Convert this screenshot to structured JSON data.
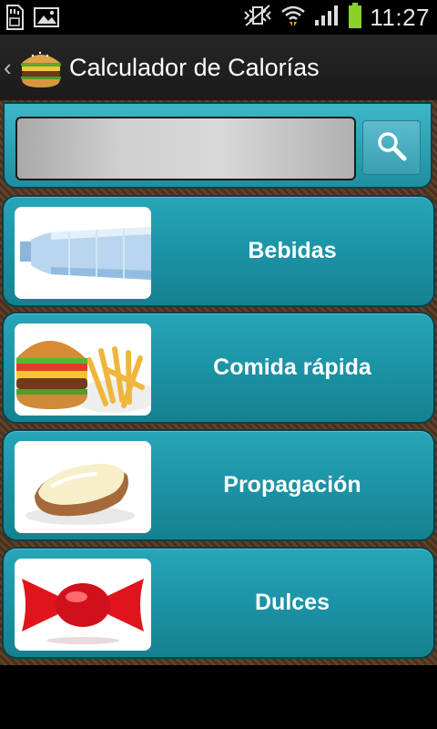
{
  "status_bar": {
    "time": "11:27",
    "icons": [
      "sd-card-icon",
      "image-icon",
      "vibrate-mute-icon",
      "wifi-icon",
      "signal-icon",
      "battery-icon"
    ]
  },
  "action_bar": {
    "title": "Calculador de Calorías",
    "logo_icon": "burger-icon"
  },
  "search": {
    "value": "",
    "placeholder": "",
    "button_icon": "search-icon"
  },
  "categories": [
    {
      "label": "Bebidas",
      "image": "water-bottle"
    },
    {
      "label": "Comida rápida",
      "image": "burger-and-fries"
    },
    {
      "label": "Propagación",
      "image": "bread-with-spread"
    },
    {
      "label": "Dulces",
      "image": "wrapped-candy"
    }
  ],
  "colors": {
    "accent": "#1c93a6",
    "panel_border": "#0b3f4a",
    "wood_background": "#5a3a22"
  }
}
